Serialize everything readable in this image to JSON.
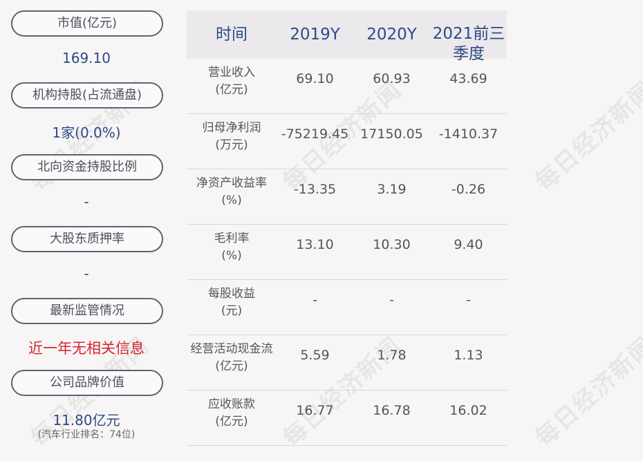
{
  "left": {
    "items": [
      {
        "label": "市值(亿元)",
        "value": "169.10"
      },
      {
        "label": "机构持股(占流通盘)",
        "value": "1家(0.0%)"
      },
      {
        "label": "北向资金持股比例",
        "value": "-"
      },
      {
        "label": "大股东质押率",
        "value": "-"
      },
      {
        "label": "最新监管情况",
        "value": "近一年无相关信息"
      },
      {
        "label": "公司品牌价值",
        "value": "11.80亿元",
        "sub": "(汽车行业排名：74位)"
      }
    ]
  },
  "table": {
    "headers": [
      "时间",
      "2019Y",
      "2020Y",
      "2021前三",
      "季度"
    ],
    "rows": [
      {
        "label1": "营业收入",
        "label2": "(亿元)",
        "values": [
          "69.10",
          "60.93",
          "43.69"
        ]
      },
      {
        "label1": "归母净利润",
        "label2": "(万元)",
        "values": [
          "-75219.45",
          "17150.05",
          "-1410.37"
        ]
      },
      {
        "label1": "净资产收益率",
        "label2": "(%)",
        "values": [
          "-13.35",
          "3.19",
          "-0.26"
        ]
      },
      {
        "label1": "毛利率",
        "label2": "(%)",
        "values": [
          "13.10",
          "10.30",
          "9.40"
        ]
      },
      {
        "label1": "每股收益",
        "label2": "(元)",
        "values": [
          "-",
          "-",
          "-"
        ]
      },
      {
        "label1": "经营活动现金流",
        "label2": "(亿元)",
        "values": [
          "5.59",
          "1.78",
          "1.13"
        ]
      },
      {
        "label1": "应收账款",
        "label2": "(亿元)",
        "values": [
          "16.77",
          "16.78",
          "16.02"
        ]
      }
    ]
  },
  "watermark": "每日经济新闻"
}
